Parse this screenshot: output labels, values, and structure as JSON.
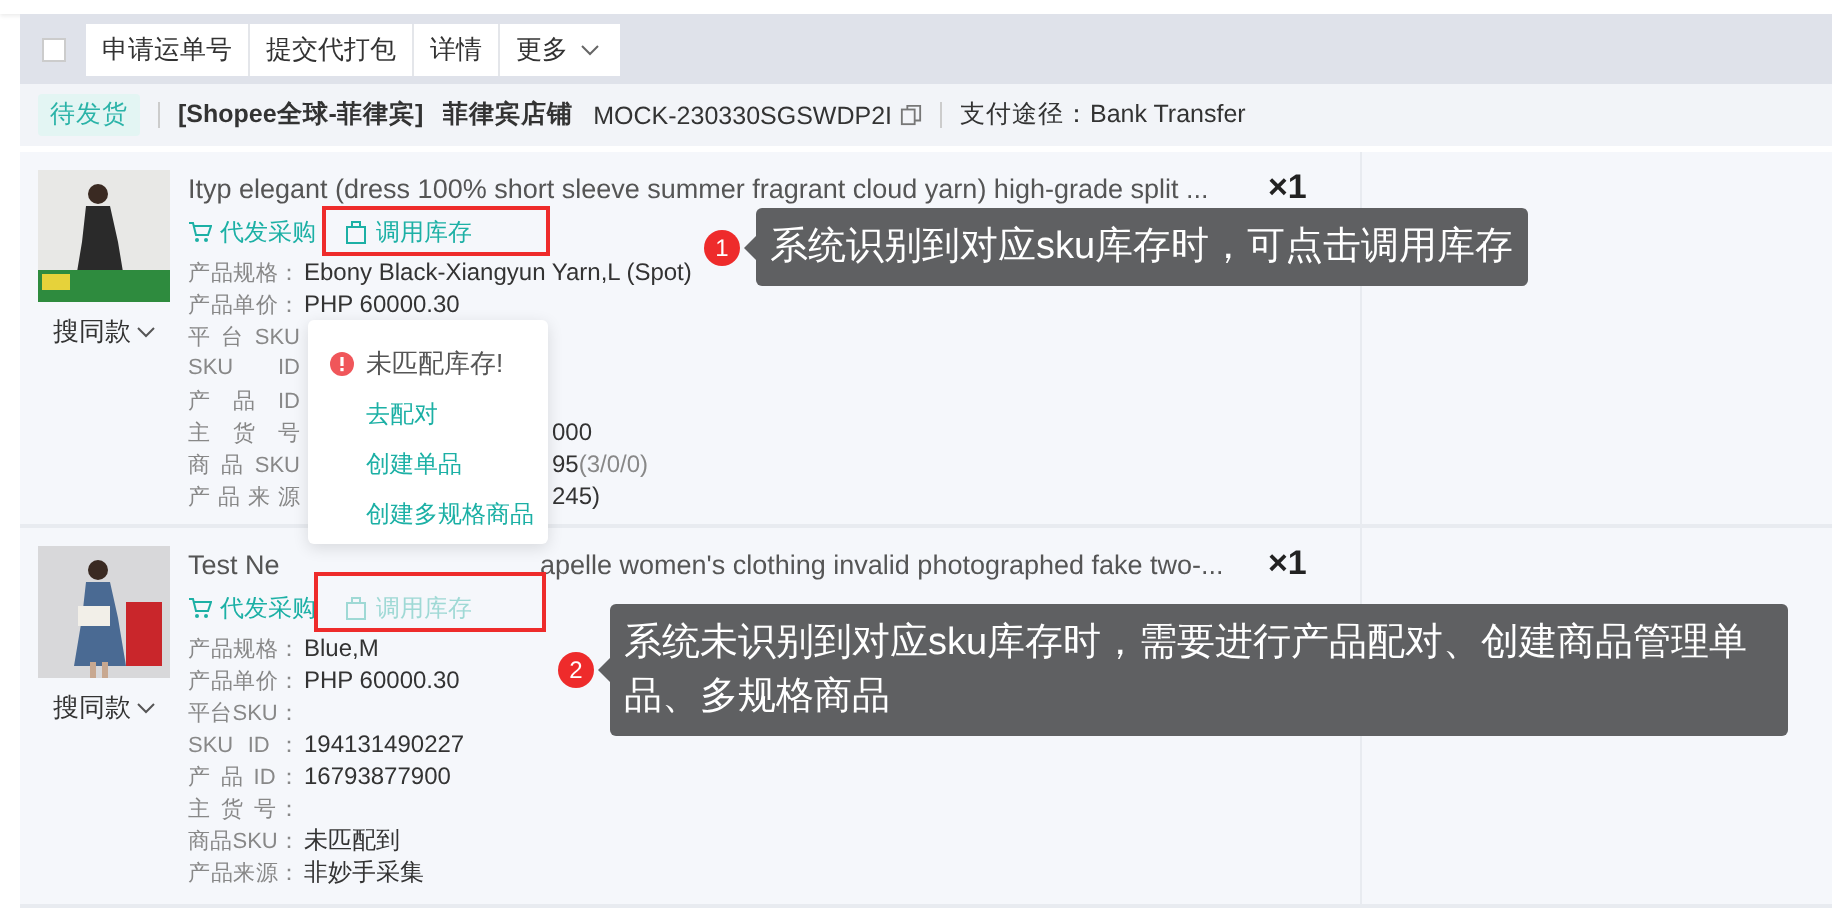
{
  "toolbar": {
    "select_all": {
      "checked": false
    },
    "buttons": [
      {
        "label": "申请运单号",
        "kind": "plain"
      },
      {
        "label": "提交代打包",
        "kind": "plain"
      },
      {
        "label": "详情",
        "kind": "plain"
      },
      {
        "label": "更多",
        "kind": "dropdown"
      }
    ]
  },
  "order": {
    "status": "待发货",
    "shop_tag": "[Shopee全球-菲律宾]",
    "shop_name": "菲律宾店铺",
    "order_no": "MOCK-230330SGSWDP2I",
    "payment": "支付途径：Bank Transfer"
  },
  "items": [
    {
      "title": [
        "Ityp elegant (dress 100% short sleeve summer fragrant cloud yarn) high-grade split ..."
      ],
      "quantity": "×1",
      "similar": "搜同款",
      "actions": [
        {
          "kind": "purchase",
          "label": "代发采购",
          "disabled": false
        },
        {
          "kind": "stock",
          "label": "调用库存",
          "disabled": false
        }
      ],
      "fields": [
        {
          "label": "产品规格：",
          "value": "Ebony Black-Xiangyun Yarn,L (Spot)"
        },
        {
          "label": "产品单价：",
          "value": "PHP 60000.30"
        },
        {
          "label": "平台SKU"
        },
        {
          "label": "SKU ID"
        },
        {
          "label": "产 品 ID"
        },
        {
          "label": "主 货 号",
          "value": "000",
          "partly_hidden": true
        },
        {
          "label": "商品SKU",
          "value": "95",
          "note": "(3/0/0)",
          "partly_hidden": true
        },
        {
          "label": "产品来源",
          "value": "245)",
          "partly_hidden": true
        }
      ]
    },
    {
      "title": [
        "Test Ne",
        "apelle women's clothing invalid photographed fake two-..."
      ],
      "quantity": "×1",
      "similar": "搜同款",
      "actions": [
        {
          "kind": "purchase",
          "label": "代发采购",
          "disabled": false
        },
        {
          "kind": "stock",
          "label": "调用库存",
          "disabled": true
        }
      ],
      "fields": [
        {
          "label": "产品规格：",
          "value": "Blue,M"
        },
        {
          "label": "产品单价：",
          "value": "PHP 60000.30"
        },
        {
          "label": "平台SKU："
        },
        {
          "label": "SKU ID：",
          "value": "194131490227"
        },
        {
          "label": "产 品 ID：",
          "value": "16793877900"
        },
        {
          "label": "主 货 号："
        },
        {
          "label": "商品SKU：",
          "value": "未匹配到"
        },
        {
          "label": "产品来源：",
          "value": "非妙手采集"
        }
      ]
    }
  ],
  "popover": {
    "title": "未匹配库存!",
    "links": [
      "去配对",
      "创建单品",
      "创建多规格商品"
    ]
  },
  "callouts": [
    {
      "number": "1",
      "text": "系统识别到对应sku库存时，可点击调用库存"
    },
    {
      "number": "2",
      "text": "系统未识别到对应sku库存时，需要进行产品配对、创建商品管理单品、多规格商品"
    }
  ]
}
